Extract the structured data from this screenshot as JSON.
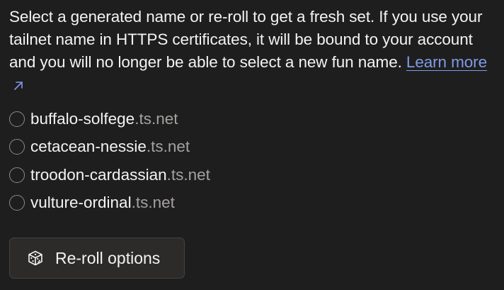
{
  "description": {
    "text": "Select a generated name or re-roll to get a fresh set. If you use your tailnet name in HTTPS certificates, it will be bound to your account and you will no longer be able to select a new fun name.",
    "link_label": "Learn more",
    "link_icon": "external-arrow-icon"
  },
  "options": [
    {
      "name": "buffalo-solfege",
      "suffix": ".ts.net"
    },
    {
      "name": "cetacean-nessie",
      "suffix": ".ts.net"
    },
    {
      "name": "troodon-cardassian",
      "suffix": ".ts.net"
    },
    {
      "name": "vulture-ordinal",
      "suffix": ".ts.net"
    }
  ],
  "reroll_button": {
    "label": "Re-roll options",
    "icon": "dice-icon"
  },
  "colors": {
    "background": "#1f1e1e",
    "text": "#f4f3f2",
    "muted_text": "#a4a2a0",
    "link": "#7d9ce6",
    "button_bg": "#2c2b2a",
    "button_border": "#44423f"
  }
}
